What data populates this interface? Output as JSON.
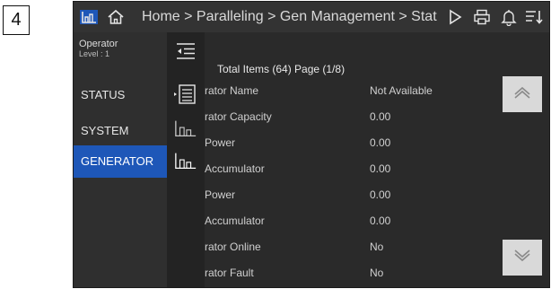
{
  "step_number": "4",
  "breadcrumb": "Home > Paralleling > Gen Management > Stat",
  "user": {
    "name": "Operator",
    "level": "Level : 1"
  },
  "nav": [
    {
      "label": "STATUS",
      "active": false
    },
    {
      "label": "SYSTEM",
      "active": false
    },
    {
      "label": "GENERATOR",
      "active": true
    }
  ],
  "list": {
    "total": "Total Items (64) Page (1/8)",
    "rows": [
      {
        "name": "rator Name",
        "value": "Not Available"
      },
      {
        "name": "rator Capacity",
        "value": "0.00"
      },
      {
        "name": "Power",
        "value": "0.00"
      },
      {
        "name": "Accumulator",
        "value": "0.00"
      },
      {
        "name": "Power",
        "value": "0.00"
      },
      {
        "name": "Accumulator",
        "value": "0.00"
      },
      {
        "name": "rator Online",
        "value": "No"
      },
      {
        "name": "rator Fault",
        "value": "No"
      }
    ]
  },
  "icons": {
    "topbar": [
      "chart-icon",
      "home-icon",
      "play-icon",
      "printer-icon",
      "bell-icon",
      "sort-icon"
    ],
    "column": [
      "collapse-menu-icon",
      "list-icon",
      "chart-icon",
      "chart-icon"
    ],
    "scroll": [
      "chevron-up-icon",
      "chevron-down-icon"
    ]
  },
  "colors": {
    "accent": "#1e57b8",
    "topbar": "#333333",
    "nav": "#2f2f2f",
    "content": "#2a2a2a"
  }
}
